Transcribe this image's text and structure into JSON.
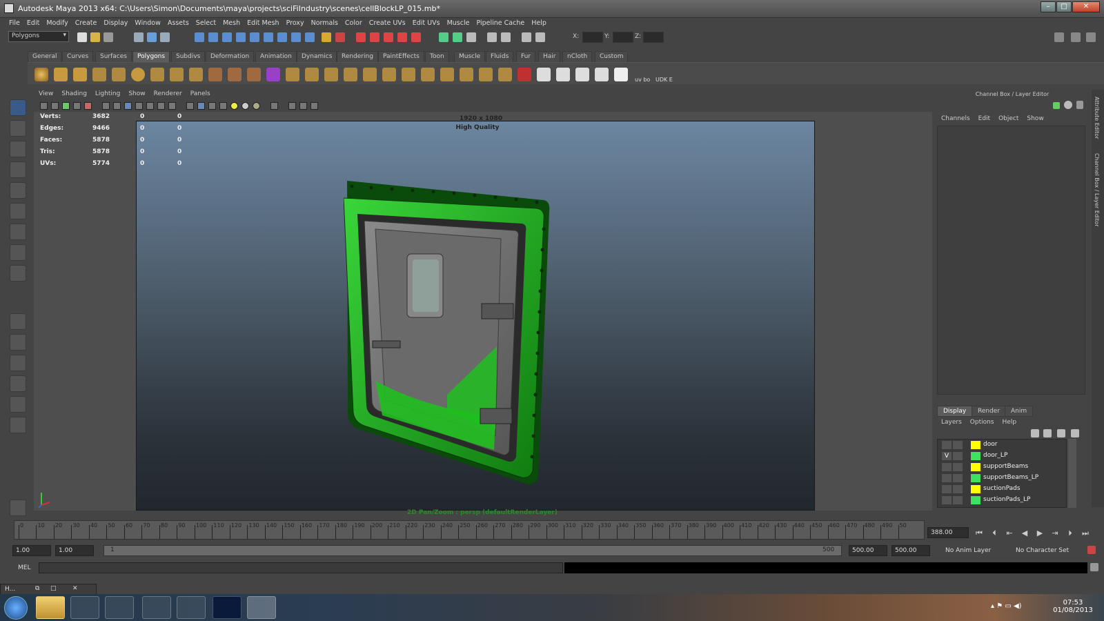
{
  "window": {
    "title": "Autodesk Maya 2013 x64: C:\\Users\\Simon\\Documents\\maya\\projects\\sciFiIndustry\\scenes\\cellBlockLP_015.mb*",
    "minimize": "–",
    "maximize": "□",
    "close": "✕"
  },
  "menubar": [
    "File",
    "Edit",
    "Modify",
    "Create",
    "Display",
    "Window",
    "Assets",
    "Select",
    "Mesh",
    "Edit Mesh",
    "Proxy",
    "Normals",
    "Color",
    "Create UVs",
    "Edit UVs",
    "Muscle",
    "Pipeline Cache",
    "Help"
  ],
  "status": {
    "menuset": "Polygons",
    "x_label": "X:",
    "y_label": "Y:",
    "z_label": "Z:"
  },
  "shelf": {
    "tabs": [
      "General",
      "Curves",
      "Surfaces",
      "Polygons",
      "Subdivs",
      "Deformation",
      "Animation",
      "Dynamics",
      "Rendering",
      "PaintEffects",
      "Toon",
      "Muscle",
      "Fluids",
      "Fur",
      "Hair",
      "nCloth",
      "Custom"
    ],
    "active_tab": "Polygons",
    "extra_labels": [
      "uv bo",
      "UDK E"
    ]
  },
  "viewport": {
    "menu": [
      "View",
      "Shading",
      "Lighting",
      "Show",
      "Renderer",
      "Panels"
    ],
    "hud": {
      "labels": [
        "Verts:",
        "Edges:",
        "Faces:",
        "Tris:",
        "UVs:"
      ],
      "values": [
        "3682",
        "9466",
        "5878",
        "5878",
        "5774"
      ],
      "zeros": "0"
    },
    "resolution": "1920 x 1080",
    "quality": "High Quality",
    "camera_label": "2D Pan/Zoom : persp (defaultRenderLayer)"
  },
  "channel_box": {
    "title": "Channel Box / Layer Editor",
    "menu": [
      "Channels",
      "Edit",
      "Object",
      "Show"
    ]
  },
  "layer_editor": {
    "tabs": [
      "Display",
      "Render",
      "Anim"
    ],
    "active_tab": "Display",
    "menu": [
      "Layers",
      "Options",
      "Help"
    ],
    "layers": [
      {
        "name": "door",
        "visible": "",
        "color": "#ffff00"
      },
      {
        "name": "door_LP",
        "visible": "V",
        "color": "#40e060"
      },
      {
        "name": "supportBeams",
        "visible": "",
        "color": "#ffff00"
      },
      {
        "name": "supportBeams_LP",
        "visible": "",
        "color": "#40e060"
      },
      {
        "name": "suctionPads",
        "visible": "",
        "color": "#ffff00"
      },
      {
        "name": "suctionPads_LP",
        "visible": "",
        "color": "#40e060"
      }
    ]
  },
  "side_tabs": [
    "Attribute Editor",
    "Channel Box / Layer Editor"
  ],
  "timeline": {
    "labels": [
      "0",
      "10",
      "20",
      "30",
      "40",
      "50",
      "60",
      "70",
      "80",
      "90",
      "100",
      "110",
      "120",
      "130",
      "140",
      "150",
      "160",
      "170",
      "180",
      "190",
      "200",
      "210",
      "220",
      "230",
      "240",
      "250",
      "260",
      "270",
      "280",
      "290",
      "300",
      "310",
      "320",
      "330",
      "340",
      "350",
      "360",
      "370",
      "380",
      "390",
      "400",
      "410",
      "420",
      "430",
      "440",
      "450",
      "460",
      "470",
      "480",
      "490",
      "50"
    ],
    "current_frame": "388.00"
  },
  "range": {
    "start": "1.00",
    "start2": "1.00",
    "slider_start": "1",
    "slider_end": "500",
    "end": "500.00",
    "end2": "500.00",
    "anim_layer": "No Anim Layer",
    "char_set": "No Character Set"
  },
  "command": {
    "label": "MEL"
  },
  "minibar": {
    "label": "H..."
  },
  "taskbar": {
    "time": "07:53",
    "date": "01/08/2013"
  },
  "colors": {
    "maya_bg": "#444444",
    "door_green": "#22c222",
    "door_metal": "#707070"
  }
}
